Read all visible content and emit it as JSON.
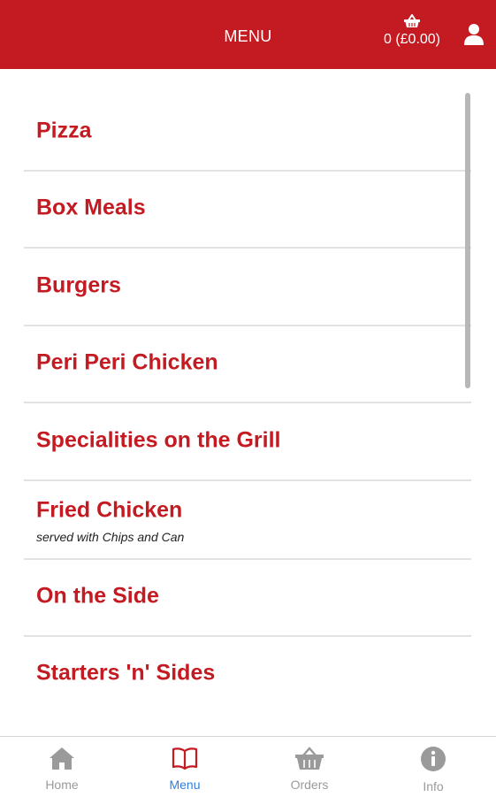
{
  "header": {
    "title": "MENU",
    "basket_total": "0 (£0.00)"
  },
  "menu": {
    "items": [
      {
        "label": "Pizza"
      },
      {
        "label": "Box Meals"
      },
      {
        "label": "Burgers"
      },
      {
        "label": "Peri Peri Chicken"
      },
      {
        "label": "Specialities on the Grill"
      },
      {
        "label": "Fried Chicken",
        "sub": "served with Chips and Can"
      },
      {
        "label": "On the Side"
      },
      {
        "label": "Starters 'n' Sides"
      }
    ]
  },
  "tabs": [
    {
      "label": "Home",
      "icon": "home-icon"
    },
    {
      "label": "Menu",
      "icon": "book-icon",
      "active": true
    },
    {
      "label": "Orders",
      "icon": "basket-icon"
    },
    {
      "label": "Info",
      "icon": "info-icon"
    }
  ],
  "colors": {
    "brand": "#c41a21",
    "active_tab": "#2f7fe0",
    "inactive_tab": "#9a9a9a"
  }
}
